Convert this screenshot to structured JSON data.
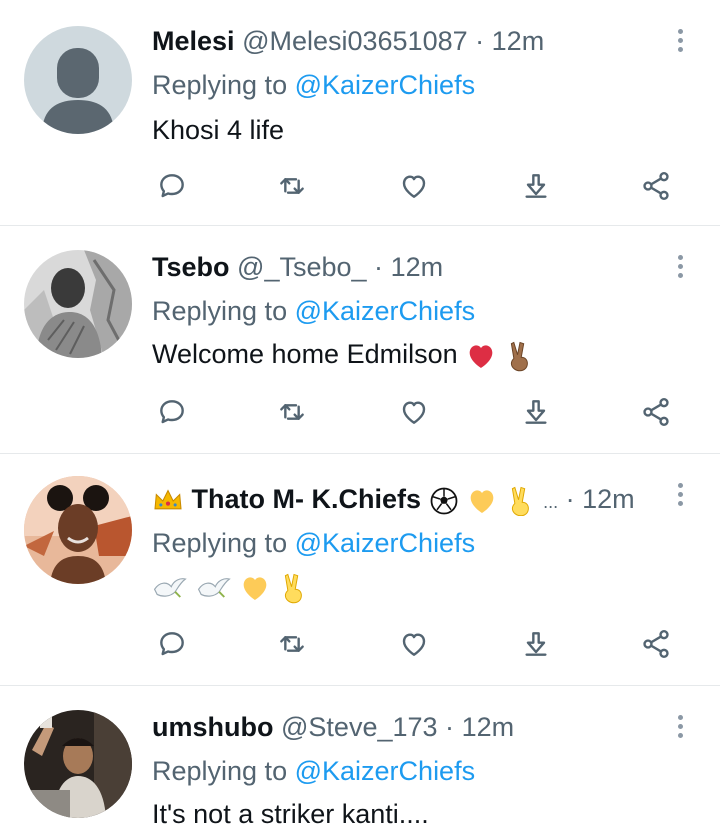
{
  "tweets": [
    {
      "name": "Melesi",
      "handle": "@Melesi03651087",
      "dot": "·",
      "time": "12m",
      "reply_prefix": "Replying to",
      "reply_mention": "@KaizerChiefs",
      "text": "Khosi 4 life",
      "avatar": "default-avatar-icon"
    },
    {
      "name": "Tsebo",
      "handle": "@_Tsebo_",
      "dot": "·",
      "time": "12m",
      "reply_prefix": "Replying to",
      "reply_mention": "@KaizerChiefs",
      "text": "Welcome home Edmilson",
      "text_emojis": [
        "red-heart-icon",
        "victory-hand-icon"
      ],
      "avatar": "user-photo"
    },
    {
      "name": "Thato M- K.Chiefs",
      "name_emojis_before": [
        "crown-icon"
      ],
      "name_emojis_after": [
        "soccer-ball-icon",
        "yellow-heart-icon",
        "victory-hand-icon"
      ],
      "truncation": "...",
      "dot": "·",
      "time": "12m",
      "reply_prefix": "Replying to",
      "reply_mention": "@KaizerChiefs",
      "text_emojis": [
        "dove-icon",
        "dove-icon",
        "yellow-heart-icon",
        "victory-hand-icon"
      ],
      "avatar": "user-photo"
    },
    {
      "name": "umshubo",
      "handle": "@Steve_173",
      "dot": "·",
      "time": "12m",
      "reply_prefix": "Replying to",
      "reply_mention": "@KaizerChiefs",
      "text": "It's not a striker kanti....",
      "avatar": "user-photo"
    }
  ],
  "action_icons": [
    "reply-icon",
    "retweet-icon",
    "like-icon",
    "download-icon",
    "share-icon"
  ],
  "colors": {
    "mention": "#1d9bf0",
    "secondary_text": "#536471",
    "icon": "#536471",
    "divider": "#e6e9eb"
  }
}
